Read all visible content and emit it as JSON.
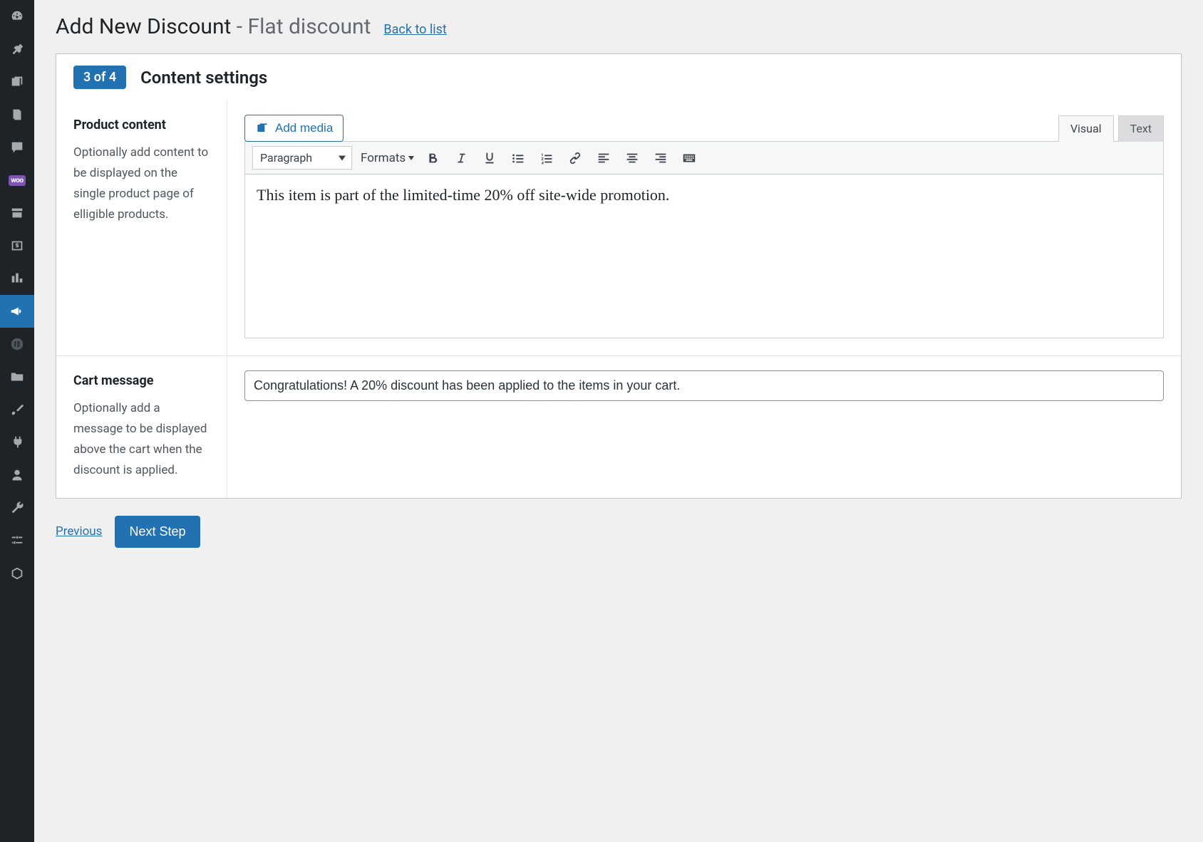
{
  "page": {
    "title": "Add New Discount",
    "subtitle": "- Flat discount",
    "back_link": "Back to list"
  },
  "panel": {
    "step_badge": "3 of 4",
    "title": "Content settings"
  },
  "product_content": {
    "heading": "Product content",
    "description": "Optionally add content to be displayed on the single product page of elligible products.",
    "add_media": "Add media",
    "tab_visual": "Visual",
    "tab_text": "Text",
    "format_select": "Paragraph",
    "formats_dropdown": "Formats",
    "body": "This item is part of the limited-time 20% off site-wide promotion."
  },
  "cart_message": {
    "heading": "Cart message",
    "description": "Optionally add a message to be displayed above the cart when the discount is applied.",
    "value": "Congratulations! A 20% discount has been applied to the items in your cart."
  },
  "footer": {
    "previous": "Previous",
    "next": "Next Step"
  },
  "sidebar": {
    "woo": "woo"
  }
}
